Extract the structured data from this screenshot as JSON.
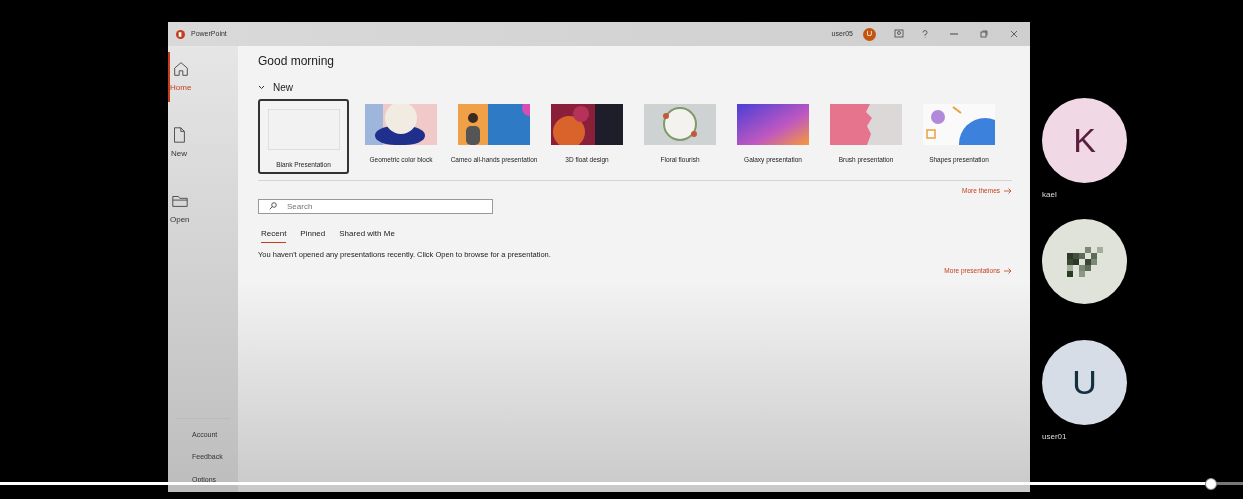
{
  "window": {
    "app_name": "PowerPoint",
    "user_name": "user05",
    "user_initial": "U"
  },
  "sidebar": {
    "items": [
      {
        "label": "Home",
        "selected": true
      },
      {
        "label": "New",
        "selected": false
      },
      {
        "label": "Open",
        "selected": false
      }
    ],
    "footer_items": [
      "Account",
      "Feedback",
      "Options"
    ]
  },
  "greeting": "Good morning",
  "new_section": {
    "title": "New",
    "expanded": true,
    "templates": [
      {
        "label": "Blank Presentation",
        "kind": "blank",
        "selected": true
      },
      {
        "label": "Geometric color block",
        "kind": "geometric",
        "selected": false
      },
      {
        "label": "Cameo all-hands presentation",
        "kind": "cameo",
        "selected": false
      },
      {
        "label": "3D float design",
        "kind": "float",
        "selected": false
      },
      {
        "label": "Floral flourish",
        "kind": "floral",
        "selected": false
      },
      {
        "label": "Galaxy presentation",
        "kind": "galaxy",
        "selected": false
      },
      {
        "label": "Brush presentation",
        "kind": "brush",
        "selected": false
      },
      {
        "label": "Shapes presentation",
        "kind": "shapes",
        "selected": false
      }
    ],
    "more_link": "More themes"
  },
  "search": {
    "placeholder": "Search"
  },
  "tabs": [
    {
      "label": "Recent",
      "selected": true
    },
    {
      "label": "Pinned",
      "selected": false
    },
    {
      "label": "Shared with Me",
      "selected": false
    }
  ],
  "empty_message": "You haven't opened any presentations recently. Click Open to browse for a presentation.",
  "more_presentations_link": "More presentations",
  "participants": [
    {
      "initial": "K",
      "name": "kael",
      "kind": "letter",
      "color": "#f0d8e4"
    },
    {
      "kind": "pixelated",
      "color": "#dfe3d9"
    },
    {
      "initial": "U",
      "name": "user01",
      "kind": "letter",
      "color": "#d6dde6"
    }
  ],
  "playback": {
    "level": 0.974
  }
}
